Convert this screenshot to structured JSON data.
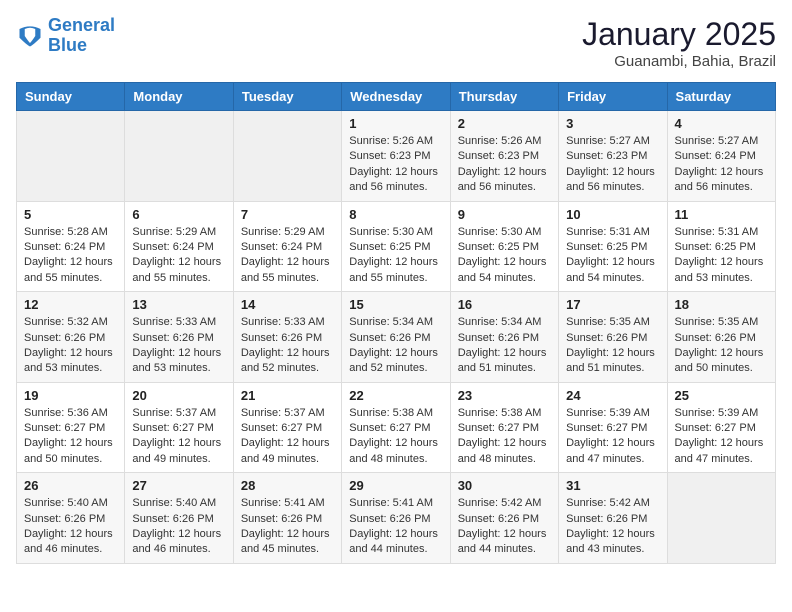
{
  "header": {
    "logo_line1": "General",
    "logo_line2": "Blue",
    "month": "January 2025",
    "location": "Guanambi, Bahia, Brazil"
  },
  "weekdays": [
    "Sunday",
    "Monday",
    "Tuesday",
    "Wednesday",
    "Thursday",
    "Friday",
    "Saturday"
  ],
  "weeks": [
    [
      {
        "day": "",
        "empty": true
      },
      {
        "day": "",
        "empty": true
      },
      {
        "day": "",
        "empty": true
      },
      {
        "day": "1",
        "sunrise": "5:26 AM",
        "sunset": "6:23 PM",
        "daylight": "12 hours and 56 minutes."
      },
      {
        "day": "2",
        "sunrise": "5:26 AM",
        "sunset": "6:23 PM",
        "daylight": "12 hours and 56 minutes."
      },
      {
        "day": "3",
        "sunrise": "5:27 AM",
        "sunset": "6:23 PM",
        "daylight": "12 hours and 56 minutes."
      },
      {
        "day": "4",
        "sunrise": "5:27 AM",
        "sunset": "6:24 PM",
        "daylight": "12 hours and 56 minutes."
      }
    ],
    [
      {
        "day": "5",
        "sunrise": "5:28 AM",
        "sunset": "6:24 PM",
        "daylight": "12 hours and 55 minutes."
      },
      {
        "day": "6",
        "sunrise": "5:29 AM",
        "sunset": "6:24 PM",
        "daylight": "12 hours and 55 minutes."
      },
      {
        "day": "7",
        "sunrise": "5:29 AM",
        "sunset": "6:24 PM",
        "daylight": "12 hours and 55 minutes."
      },
      {
        "day": "8",
        "sunrise": "5:30 AM",
        "sunset": "6:25 PM",
        "daylight": "12 hours and 55 minutes."
      },
      {
        "day": "9",
        "sunrise": "5:30 AM",
        "sunset": "6:25 PM",
        "daylight": "12 hours and 54 minutes."
      },
      {
        "day": "10",
        "sunrise": "5:31 AM",
        "sunset": "6:25 PM",
        "daylight": "12 hours and 54 minutes."
      },
      {
        "day": "11",
        "sunrise": "5:31 AM",
        "sunset": "6:25 PM",
        "daylight": "12 hours and 53 minutes."
      }
    ],
    [
      {
        "day": "12",
        "sunrise": "5:32 AM",
        "sunset": "6:26 PM",
        "daylight": "12 hours and 53 minutes."
      },
      {
        "day": "13",
        "sunrise": "5:33 AM",
        "sunset": "6:26 PM",
        "daylight": "12 hours and 53 minutes."
      },
      {
        "day": "14",
        "sunrise": "5:33 AM",
        "sunset": "6:26 PM",
        "daylight": "12 hours and 52 minutes."
      },
      {
        "day": "15",
        "sunrise": "5:34 AM",
        "sunset": "6:26 PM",
        "daylight": "12 hours and 52 minutes."
      },
      {
        "day": "16",
        "sunrise": "5:34 AM",
        "sunset": "6:26 PM",
        "daylight": "12 hours and 51 minutes."
      },
      {
        "day": "17",
        "sunrise": "5:35 AM",
        "sunset": "6:26 PM",
        "daylight": "12 hours and 51 minutes."
      },
      {
        "day": "18",
        "sunrise": "5:35 AM",
        "sunset": "6:26 PM",
        "daylight": "12 hours and 50 minutes."
      }
    ],
    [
      {
        "day": "19",
        "sunrise": "5:36 AM",
        "sunset": "6:27 PM",
        "daylight": "12 hours and 50 minutes."
      },
      {
        "day": "20",
        "sunrise": "5:37 AM",
        "sunset": "6:27 PM",
        "daylight": "12 hours and 49 minutes."
      },
      {
        "day": "21",
        "sunrise": "5:37 AM",
        "sunset": "6:27 PM",
        "daylight": "12 hours and 49 minutes."
      },
      {
        "day": "22",
        "sunrise": "5:38 AM",
        "sunset": "6:27 PM",
        "daylight": "12 hours and 48 minutes."
      },
      {
        "day": "23",
        "sunrise": "5:38 AM",
        "sunset": "6:27 PM",
        "daylight": "12 hours and 48 minutes."
      },
      {
        "day": "24",
        "sunrise": "5:39 AM",
        "sunset": "6:27 PM",
        "daylight": "12 hours and 47 minutes."
      },
      {
        "day": "25",
        "sunrise": "5:39 AM",
        "sunset": "6:27 PM",
        "daylight": "12 hours and 47 minutes."
      }
    ],
    [
      {
        "day": "26",
        "sunrise": "5:40 AM",
        "sunset": "6:26 PM",
        "daylight": "12 hours and 46 minutes."
      },
      {
        "day": "27",
        "sunrise": "5:40 AM",
        "sunset": "6:26 PM",
        "daylight": "12 hours and 46 minutes."
      },
      {
        "day": "28",
        "sunrise": "5:41 AM",
        "sunset": "6:26 PM",
        "daylight": "12 hours and 45 minutes."
      },
      {
        "day": "29",
        "sunrise": "5:41 AM",
        "sunset": "6:26 PM",
        "daylight": "12 hours and 44 minutes."
      },
      {
        "day": "30",
        "sunrise": "5:42 AM",
        "sunset": "6:26 PM",
        "daylight": "12 hours and 44 minutes."
      },
      {
        "day": "31",
        "sunrise": "5:42 AM",
        "sunset": "6:26 PM",
        "daylight": "12 hours and 43 minutes."
      },
      {
        "day": "",
        "empty": true
      }
    ]
  ]
}
